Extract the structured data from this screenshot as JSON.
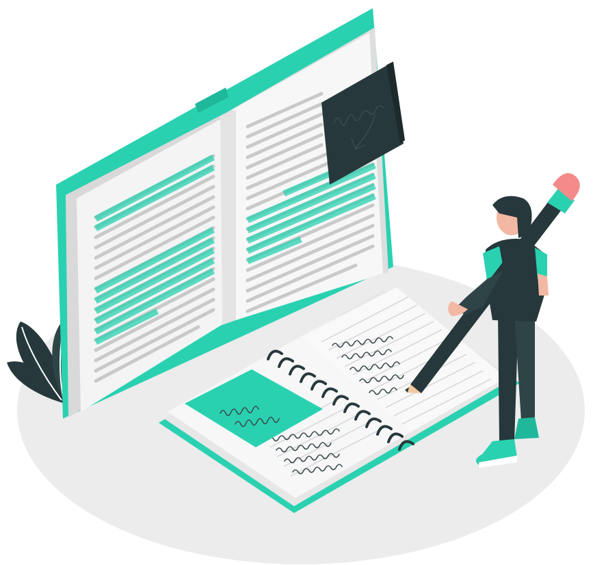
{
  "illustration": {
    "colors": {
      "accent": "#2ad1b1",
      "accent_dark": "#1fb89b",
      "ink": "#26383b",
      "page": "#f3f3f3",
      "page_shadow": "#dcdcdc",
      "text_line": "#c7c7c7",
      "floor": "#ebebeb",
      "skin": "#f2b8a4",
      "pencil_pink": "#f58a8a"
    },
    "icons": [
      "open-book",
      "sticky-note",
      "spiral-notebook",
      "pencil",
      "person",
      "leaves"
    ]
  }
}
